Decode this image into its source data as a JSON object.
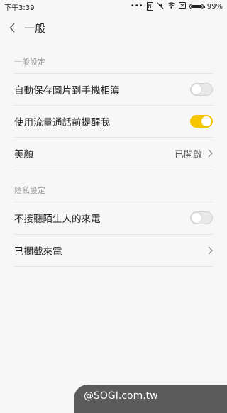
{
  "status_bar": {
    "time": "下午3:39",
    "battery": "99%",
    "dots": "•••",
    "nfc": "N"
  },
  "header": {
    "title": "一般"
  },
  "sections": [
    {
      "header": "一般設定"
    },
    {
      "header": "隱私設定"
    }
  ],
  "rows": {
    "auto_save": {
      "label": "自動保存圖片到手機相簿",
      "on": false
    },
    "data_remind": {
      "label": "使用流量通話前提醒我",
      "on": true
    },
    "beauty": {
      "label": "美顏",
      "value": "已開啟"
    },
    "stranger_calls": {
      "label": "不接聽陌生人的來電",
      "on": false
    },
    "blocked_calls": {
      "label": "已攔截來電"
    }
  },
  "watermark": "@SOGI.com.tw",
  "colors": {
    "accent": "#f6c400",
    "background": "#f7f7f7",
    "divider": "#e4e4e4"
  }
}
